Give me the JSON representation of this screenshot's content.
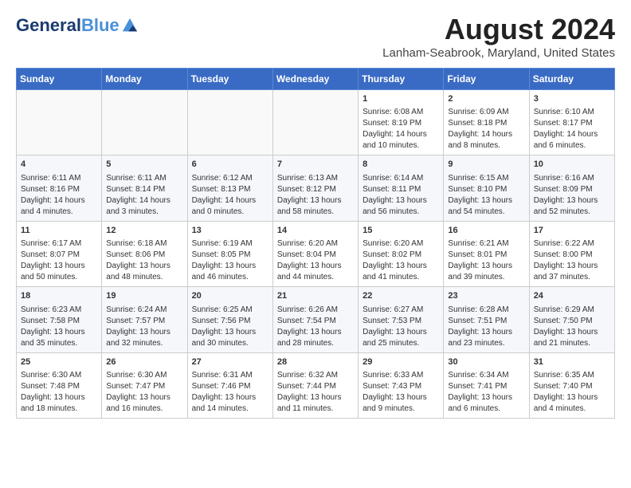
{
  "logo": {
    "line1": "General",
    "line2": "Blue"
  },
  "header": {
    "month_year": "August 2024",
    "location": "Lanham-Seabrook, Maryland, United States"
  },
  "days_of_week": [
    "Sunday",
    "Monday",
    "Tuesday",
    "Wednesday",
    "Thursday",
    "Friday",
    "Saturday"
  ],
  "weeks": [
    [
      {
        "day": "",
        "info": ""
      },
      {
        "day": "",
        "info": ""
      },
      {
        "day": "",
        "info": ""
      },
      {
        "day": "",
        "info": ""
      },
      {
        "day": "1",
        "info": "Sunrise: 6:08 AM\nSunset: 8:19 PM\nDaylight: 14 hours\nand 10 minutes."
      },
      {
        "day": "2",
        "info": "Sunrise: 6:09 AM\nSunset: 8:18 PM\nDaylight: 14 hours\nand 8 minutes."
      },
      {
        "day": "3",
        "info": "Sunrise: 6:10 AM\nSunset: 8:17 PM\nDaylight: 14 hours\nand 6 minutes."
      }
    ],
    [
      {
        "day": "4",
        "info": "Sunrise: 6:11 AM\nSunset: 8:16 PM\nDaylight: 14 hours\nand 4 minutes."
      },
      {
        "day": "5",
        "info": "Sunrise: 6:11 AM\nSunset: 8:14 PM\nDaylight: 14 hours\nand 3 minutes."
      },
      {
        "day": "6",
        "info": "Sunrise: 6:12 AM\nSunset: 8:13 PM\nDaylight: 14 hours\nand 0 minutes."
      },
      {
        "day": "7",
        "info": "Sunrise: 6:13 AM\nSunset: 8:12 PM\nDaylight: 13 hours\nand 58 minutes."
      },
      {
        "day": "8",
        "info": "Sunrise: 6:14 AM\nSunset: 8:11 PM\nDaylight: 13 hours\nand 56 minutes."
      },
      {
        "day": "9",
        "info": "Sunrise: 6:15 AM\nSunset: 8:10 PM\nDaylight: 13 hours\nand 54 minutes."
      },
      {
        "day": "10",
        "info": "Sunrise: 6:16 AM\nSunset: 8:09 PM\nDaylight: 13 hours\nand 52 minutes."
      }
    ],
    [
      {
        "day": "11",
        "info": "Sunrise: 6:17 AM\nSunset: 8:07 PM\nDaylight: 13 hours\nand 50 minutes."
      },
      {
        "day": "12",
        "info": "Sunrise: 6:18 AM\nSunset: 8:06 PM\nDaylight: 13 hours\nand 48 minutes."
      },
      {
        "day": "13",
        "info": "Sunrise: 6:19 AM\nSunset: 8:05 PM\nDaylight: 13 hours\nand 46 minutes."
      },
      {
        "day": "14",
        "info": "Sunrise: 6:20 AM\nSunset: 8:04 PM\nDaylight: 13 hours\nand 44 minutes."
      },
      {
        "day": "15",
        "info": "Sunrise: 6:20 AM\nSunset: 8:02 PM\nDaylight: 13 hours\nand 41 minutes."
      },
      {
        "day": "16",
        "info": "Sunrise: 6:21 AM\nSunset: 8:01 PM\nDaylight: 13 hours\nand 39 minutes."
      },
      {
        "day": "17",
        "info": "Sunrise: 6:22 AM\nSunset: 8:00 PM\nDaylight: 13 hours\nand 37 minutes."
      }
    ],
    [
      {
        "day": "18",
        "info": "Sunrise: 6:23 AM\nSunset: 7:58 PM\nDaylight: 13 hours\nand 35 minutes."
      },
      {
        "day": "19",
        "info": "Sunrise: 6:24 AM\nSunset: 7:57 PM\nDaylight: 13 hours\nand 32 minutes."
      },
      {
        "day": "20",
        "info": "Sunrise: 6:25 AM\nSunset: 7:56 PM\nDaylight: 13 hours\nand 30 minutes."
      },
      {
        "day": "21",
        "info": "Sunrise: 6:26 AM\nSunset: 7:54 PM\nDaylight: 13 hours\nand 28 minutes."
      },
      {
        "day": "22",
        "info": "Sunrise: 6:27 AM\nSunset: 7:53 PM\nDaylight: 13 hours\nand 25 minutes."
      },
      {
        "day": "23",
        "info": "Sunrise: 6:28 AM\nSunset: 7:51 PM\nDaylight: 13 hours\nand 23 minutes."
      },
      {
        "day": "24",
        "info": "Sunrise: 6:29 AM\nSunset: 7:50 PM\nDaylight: 13 hours\nand 21 minutes."
      }
    ],
    [
      {
        "day": "25",
        "info": "Sunrise: 6:30 AM\nSunset: 7:48 PM\nDaylight: 13 hours\nand 18 minutes."
      },
      {
        "day": "26",
        "info": "Sunrise: 6:30 AM\nSunset: 7:47 PM\nDaylight: 13 hours\nand 16 minutes."
      },
      {
        "day": "27",
        "info": "Sunrise: 6:31 AM\nSunset: 7:46 PM\nDaylight: 13 hours\nand 14 minutes."
      },
      {
        "day": "28",
        "info": "Sunrise: 6:32 AM\nSunset: 7:44 PM\nDaylight: 13 hours\nand 11 minutes."
      },
      {
        "day": "29",
        "info": "Sunrise: 6:33 AM\nSunset: 7:43 PM\nDaylight: 13 hours\nand 9 minutes."
      },
      {
        "day": "30",
        "info": "Sunrise: 6:34 AM\nSunset: 7:41 PM\nDaylight: 13 hours\nand 6 minutes."
      },
      {
        "day": "31",
        "info": "Sunrise: 6:35 AM\nSunset: 7:40 PM\nDaylight: 13 hours\nand 4 minutes."
      }
    ]
  ]
}
